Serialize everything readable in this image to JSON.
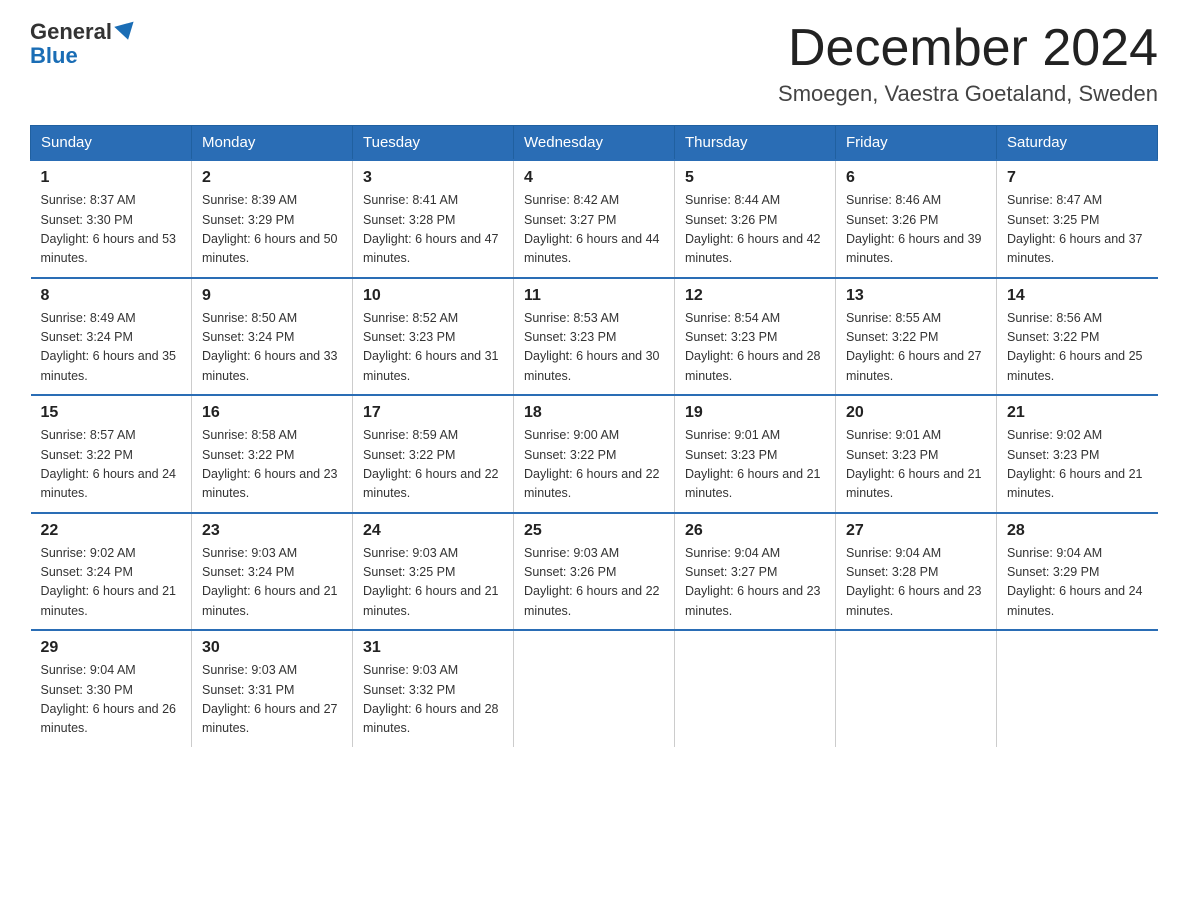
{
  "header": {
    "logo_general": "General",
    "logo_blue": "Blue",
    "month_title": "December 2024",
    "location": "Smoegen, Vaestra Goetaland, Sweden"
  },
  "days_of_week": [
    "Sunday",
    "Monday",
    "Tuesday",
    "Wednesday",
    "Thursday",
    "Friday",
    "Saturday"
  ],
  "weeks": [
    [
      {
        "day": "1",
        "sunrise": "Sunrise: 8:37 AM",
        "sunset": "Sunset: 3:30 PM",
        "daylight": "Daylight: 6 hours and 53 minutes."
      },
      {
        "day": "2",
        "sunrise": "Sunrise: 8:39 AM",
        "sunset": "Sunset: 3:29 PM",
        "daylight": "Daylight: 6 hours and 50 minutes."
      },
      {
        "day": "3",
        "sunrise": "Sunrise: 8:41 AM",
        "sunset": "Sunset: 3:28 PM",
        "daylight": "Daylight: 6 hours and 47 minutes."
      },
      {
        "day": "4",
        "sunrise": "Sunrise: 8:42 AM",
        "sunset": "Sunset: 3:27 PM",
        "daylight": "Daylight: 6 hours and 44 minutes."
      },
      {
        "day": "5",
        "sunrise": "Sunrise: 8:44 AM",
        "sunset": "Sunset: 3:26 PM",
        "daylight": "Daylight: 6 hours and 42 minutes."
      },
      {
        "day": "6",
        "sunrise": "Sunrise: 8:46 AM",
        "sunset": "Sunset: 3:26 PM",
        "daylight": "Daylight: 6 hours and 39 minutes."
      },
      {
        "day": "7",
        "sunrise": "Sunrise: 8:47 AM",
        "sunset": "Sunset: 3:25 PM",
        "daylight": "Daylight: 6 hours and 37 minutes."
      }
    ],
    [
      {
        "day": "8",
        "sunrise": "Sunrise: 8:49 AM",
        "sunset": "Sunset: 3:24 PM",
        "daylight": "Daylight: 6 hours and 35 minutes."
      },
      {
        "day": "9",
        "sunrise": "Sunrise: 8:50 AM",
        "sunset": "Sunset: 3:24 PM",
        "daylight": "Daylight: 6 hours and 33 minutes."
      },
      {
        "day": "10",
        "sunrise": "Sunrise: 8:52 AM",
        "sunset": "Sunset: 3:23 PM",
        "daylight": "Daylight: 6 hours and 31 minutes."
      },
      {
        "day": "11",
        "sunrise": "Sunrise: 8:53 AM",
        "sunset": "Sunset: 3:23 PM",
        "daylight": "Daylight: 6 hours and 30 minutes."
      },
      {
        "day": "12",
        "sunrise": "Sunrise: 8:54 AM",
        "sunset": "Sunset: 3:23 PM",
        "daylight": "Daylight: 6 hours and 28 minutes."
      },
      {
        "day": "13",
        "sunrise": "Sunrise: 8:55 AM",
        "sunset": "Sunset: 3:22 PM",
        "daylight": "Daylight: 6 hours and 27 minutes."
      },
      {
        "day": "14",
        "sunrise": "Sunrise: 8:56 AM",
        "sunset": "Sunset: 3:22 PM",
        "daylight": "Daylight: 6 hours and 25 minutes."
      }
    ],
    [
      {
        "day": "15",
        "sunrise": "Sunrise: 8:57 AM",
        "sunset": "Sunset: 3:22 PM",
        "daylight": "Daylight: 6 hours and 24 minutes."
      },
      {
        "day": "16",
        "sunrise": "Sunrise: 8:58 AM",
        "sunset": "Sunset: 3:22 PM",
        "daylight": "Daylight: 6 hours and 23 minutes."
      },
      {
        "day": "17",
        "sunrise": "Sunrise: 8:59 AM",
        "sunset": "Sunset: 3:22 PM",
        "daylight": "Daylight: 6 hours and 22 minutes."
      },
      {
        "day": "18",
        "sunrise": "Sunrise: 9:00 AM",
        "sunset": "Sunset: 3:22 PM",
        "daylight": "Daylight: 6 hours and 22 minutes."
      },
      {
        "day": "19",
        "sunrise": "Sunrise: 9:01 AM",
        "sunset": "Sunset: 3:23 PM",
        "daylight": "Daylight: 6 hours and 21 minutes."
      },
      {
        "day": "20",
        "sunrise": "Sunrise: 9:01 AM",
        "sunset": "Sunset: 3:23 PM",
        "daylight": "Daylight: 6 hours and 21 minutes."
      },
      {
        "day": "21",
        "sunrise": "Sunrise: 9:02 AM",
        "sunset": "Sunset: 3:23 PM",
        "daylight": "Daylight: 6 hours and 21 minutes."
      }
    ],
    [
      {
        "day": "22",
        "sunrise": "Sunrise: 9:02 AM",
        "sunset": "Sunset: 3:24 PM",
        "daylight": "Daylight: 6 hours and 21 minutes."
      },
      {
        "day": "23",
        "sunrise": "Sunrise: 9:03 AM",
        "sunset": "Sunset: 3:24 PM",
        "daylight": "Daylight: 6 hours and 21 minutes."
      },
      {
        "day": "24",
        "sunrise": "Sunrise: 9:03 AM",
        "sunset": "Sunset: 3:25 PM",
        "daylight": "Daylight: 6 hours and 21 minutes."
      },
      {
        "day": "25",
        "sunrise": "Sunrise: 9:03 AM",
        "sunset": "Sunset: 3:26 PM",
        "daylight": "Daylight: 6 hours and 22 minutes."
      },
      {
        "day": "26",
        "sunrise": "Sunrise: 9:04 AM",
        "sunset": "Sunset: 3:27 PM",
        "daylight": "Daylight: 6 hours and 23 minutes."
      },
      {
        "day": "27",
        "sunrise": "Sunrise: 9:04 AM",
        "sunset": "Sunset: 3:28 PM",
        "daylight": "Daylight: 6 hours and 23 minutes."
      },
      {
        "day": "28",
        "sunrise": "Sunrise: 9:04 AM",
        "sunset": "Sunset: 3:29 PM",
        "daylight": "Daylight: 6 hours and 24 minutes."
      }
    ],
    [
      {
        "day": "29",
        "sunrise": "Sunrise: 9:04 AM",
        "sunset": "Sunset: 3:30 PM",
        "daylight": "Daylight: 6 hours and 26 minutes."
      },
      {
        "day": "30",
        "sunrise": "Sunrise: 9:03 AM",
        "sunset": "Sunset: 3:31 PM",
        "daylight": "Daylight: 6 hours and 27 minutes."
      },
      {
        "day": "31",
        "sunrise": "Sunrise: 9:03 AM",
        "sunset": "Sunset: 3:32 PM",
        "daylight": "Daylight: 6 hours and 28 minutes."
      },
      {
        "day": "",
        "sunrise": "",
        "sunset": "",
        "daylight": ""
      },
      {
        "day": "",
        "sunrise": "",
        "sunset": "",
        "daylight": ""
      },
      {
        "day": "",
        "sunrise": "",
        "sunset": "",
        "daylight": ""
      },
      {
        "day": "",
        "sunrise": "",
        "sunset": "",
        "daylight": ""
      }
    ]
  ]
}
